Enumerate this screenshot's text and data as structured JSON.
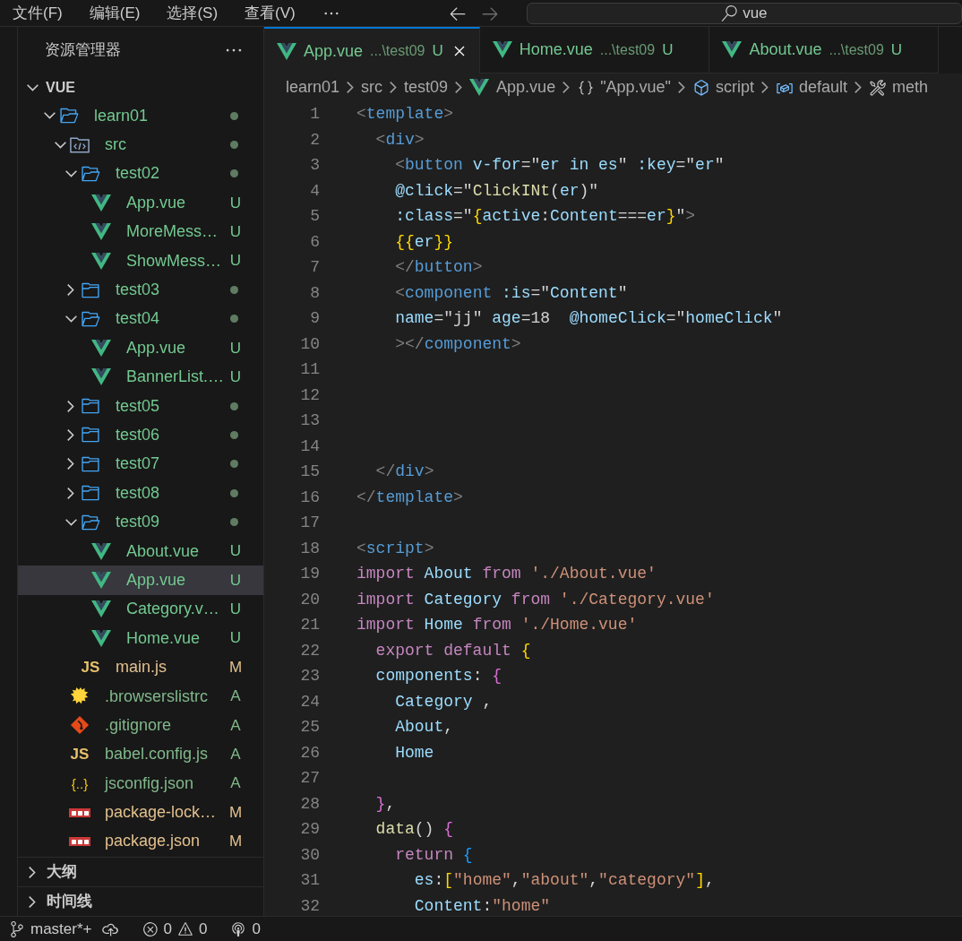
{
  "menu": [
    "文件(F)",
    "编辑(E)",
    "选择(S)",
    "查看(V)"
  ],
  "search": {
    "value": "vue"
  },
  "sidebar": {
    "title": "资源管理器",
    "section": {
      "title": "VUE",
      "expanded": true
    },
    "tree": [
      {
        "name": "learn01",
        "kind": "folder",
        "expanded": true,
        "has_changes": true,
        "children": [
          {
            "name": "src",
            "kind": "src-folder",
            "expanded": true,
            "has_changes": true,
            "children": [
              {
                "name": "test02",
                "kind": "folder",
                "expanded": true,
                "has_changes": true,
                "children": [
                  {
                    "name": "App.vue",
                    "kind": "vue",
                    "status": "U",
                    "selected": false
                  },
                  {
                    "name": "MoreMess…",
                    "kind": "vue",
                    "status": "U",
                    "selected": false
                  },
                  {
                    "name": "ShowMess…",
                    "kind": "vue",
                    "status": "U",
                    "selected": false
                  }
                ]
              },
              {
                "name": "test03",
                "kind": "folder",
                "expanded": false,
                "has_changes": true
              },
              {
                "name": "test04",
                "kind": "folder",
                "expanded": true,
                "has_changes": true,
                "children": [
                  {
                    "name": "App.vue",
                    "kind": "vue",
                    "status": "U",
                    "selected": false
                  },
                  {
                    "name": "BannerList.…",
                    "kind": "vue",
                    "status": "U",
                    "selected": false
                  }
                ]
              },
              {
                "name": "test05",
                "kind": "folder",
                "expanded": false,
                "has_changes": true
              },
              {
                "name": "test06",
                "kind": "folder",
                "expanded": false,
                "has_changes": true
              },
              {
                "name": "test07",
                "kind": "folder",
                "expanded": false,
                "has_changes": true
              },
              {
                "name": "test08",
                "kind": "folder",
                "expanded": false,
                "has_changes": true
              },
              {
                "name": "test09",
                "kind": "folder",
                "expanded": true,
                "has_changes": true,
                "children": [
                  {
                    "name": "About.vue",
                    "kind": "vue",
                    "status": "U",
                    "selected": false
                  },
                  {
                    "name": "App.vue",
                    "kind": "vue",
                    "status": "U",
                    "selected": true
                  },
                  {
                    "name": "Category.v…",
                    "kind": "vue",
                    "status": "U",
                    "selected": false
                  },
                  {
                    "name": "Home.vue",
                    "kind": "vue",
                    "status": "U",
                    "selected": false
                  }
                ]
              },
              {
                "name": "main.js",
                "kind": "js",
                "icon_text": "JS",
                "status": "M",
                "selected": false
              }
            ]
          },
          {
            "name": ".browserslistrc",
            "kind": "browserslist",
            "status": "A",
            "selected": false
          },
          {
            "name": ".gitignore",
            "kind": "git",
            "status": "A",
            "selected": false
          },
          {
            "name": "babel.config.js",
            "kind": "js",
            "icon_text": "JS",
            "status": "A",
            "selected": false
          },
          {
            "name": "jsconfig.json",
            "kind": "json",
            "icon_text": "{..}",
            "status": "A",
            "selected": false
          },
          {
            "name": "package-lock…",
            "kind": "npm",
            "status": "M",
            "selected": false
          },
          {
            "name": "package.json",
            "kind": "npm",
            "status": "M",
            "selected": false
          }
        ]
      }
    ],
    "panels": [
      {
        "title": "大纲",
        "expanded": false
      },
      {
        "title": "时间线",
        "expanded": false
      }
    ]
  },
  "tabs": [
    {
      "name": "App.vue",
      "path": "...\\test09",
      "status": "U",
      "selected": true
    },
    {
      "name": "Home.vue",
      "path": "...\\test09",
      "status": "U",
      "selected": false
    },
    {
      "name": "About.vue",
      "path": "...\\test09",
      "status": "U",
      "selected": false
    }
  ],
  "breadcrumb": [
    {
      "text": "learn01",
      "kind": "folder"
    },
    {
      "text": "src",
      "kind": "folder"
    },
    {
      "text": "test09",
      "kind": "folder"
    },
    {
      "text": "App.vue",
      "kind": "vue"
    },
    {
      "text": "\"App.vue\"",
      "kind": "braces"
    },
    {
      "text": "script",
      "kind": "method"
    },
    {
      "text": "default",
      "kind": "variable"
    },
    {
      "text": "meth",
      "kind": "tool"
    }
  ],
  "code": [
    {
      "number": "1",
      "tokens": [
        {
          "text": "<",
          "kind": "punct"
        },
        {
          "text": "template",
          "kind": "tag"
        },
        {
          "text": ">",
          "kind": "punct"
        }
      ]
    },
    {
      "number": "2",
      "tokens": [
        {
          "text": "  <",
          "kind": "punct"
        },
        {
          "text": "div",
          "kind": "tag"
        },
        {
          "text": ">",
          "kind": "punct"
        }
      ]
    },
    {
      "number": "3",
      "tokens": [
        {
          "text": "    <",
          "kind": "punct"
        },
        {
          "text": "button",
          "kind": "tag"
        },
        {
          "text": " v-for",
          "kind": "attr"
        },
        {
          "text": "=\"",
          "kind": "plain"
        },
        {
          "text": "er in es",
          "kind": "var"
        },
        {
          "text": "\" ",
          "kind": "plain"
        },
        {
          "text": ":key",
          "kind": "attr"
        },
        {
          "text": "=\"",
          "kind": "plain"
        },
        {
          "text": "er",
          "kind": "var"
        },
        {
          "text": "\"",
          "kind": "plain"
        }
      ]
    },
    {
      "number": "4",
      "tokens": [
        {
          "text": "    @click",
          "kind": "attr"
        },
        {
          "text": "=\"",
          "kind": "plain"
        },
        {
          "text": "ClickINt",
          "kind": "func"
        },
        {
          "text": "(",
          "kind": "plain"
        },
        {
          "text": "er",
          "kind": "var"
        },
        {
          "text": ")\"",
          "kind": "plain"
        }
      ]
    },
    {
      "number": "5",
      "tokens": [
        {
          "text": "    :class",
          "kind": "attr"
        },
        {
          "text": "=\"",
          "kind": "plain"
        },
        {
          "text": "{",
          "kind": "brace1"
        },
        {
          "text": "active",
          "kind": "var"
        },
        {
          "text": ":",
          "kind": "plain"
        },
        {
          "text": "Content",
          "kind": "var"
        },
        {
          "text": "===",
          "kind": "plain"
        },
        {
          "text": "er",
          "kind": "var"
        },
        {
          "text": "}",
          "kind": "brace1"
        },
        {
          "text": "\"",
          "kind": "plain"
        },
        {
          "text": ">",
          "kind": "punct"
        }
      ]
    },
    {
      "number": "6",
      "tokens": [
        {
          "text": "    {{",
          "kind": "brace1"
        },
        {
          "text": "er",
          "kind": "var"
        },
        {
          "text": "}}",
          "kind": "brace1"
        }
      ]
    },
    {
      "number": "7",
      "tokens": [
        {
          "text": "    </",
          "kind": "punct"
        },
        {
          "text": "button",
          "kind": "tag"
        },
        {
          "text": ">",
          "kind": "punct"
        }
      ]
    },
    {
      "number": "8",
      "tokens": [
        {
          "text": "    <",
          "kind": "punct"
        },
        {
          "text": "component",
          "kind": "tag"
        },
        {
          "text": " :is",
          "kind": "attr"
        },
        {
          "text": "=\"",
          "kind": "plain"
        },
        {
          "text": "Content",
          "kind": "var"
        },
        {
          "text": "\"",
          "kind": "plain"
        }
      ]
    },
    {
      "number": "9",
      "tokens": [
        {
          "text": "    name",
          "kind": "attr"
        },
        {
          "text": "=\"jj\"",
          "kind": "plain"
        },
        {
          "text": " age",
          "kind": "attr"
        },
        {
          "text": "=18  ",
          "kind": "plain"
        },
        {
          "text": "@homeClick",
          "kind": "attr"
        },
        {
          "text": "=\"",
          "kind": "plain"
        },
        {
          "text": "homeClick",
          "kind": "var"
        },
        {
          "text": "\"",
          "kind": "plain"
        }
      ]
    },
    {
      "number": "10",
      "tokens": [
        {
          "text": "    ></",
          "kind": "punct"
        },
        {
          "text": "component",
          "kind": "tag"
        },
        {
          "text": ">",
          "kind": "punct"
        }
      ]
    },
    {
      "number": "11"
    },
    {
      "number": "12"
    },
    {
      "number": "13"
    },
    {
      "number": "14"
    },
    {
      "number": "15",
      "tokens": [
        {
          "text": "  </",
          "kind": "punct"
        },
        {
          "text": "div",
          "kind": "tag"
        },
        {
          "text": ">",
          "kind": "punct"
        }
      ]
    },
    {
      "number": "16",
      "tokens": [
        {
          "text": "</",
          "kind": "punct"
        },
        {
          "text": "template",
          "kind": "tag"
        },
        {
          "text": ">",
          "kind": "punct"
        }
      ]
    },
    {
      "number": "17"
    },
    {
      "number": "18",
      "tokens": [
        {
          "text": "<",
          "kind": "punct"
        },
        {
          "text": "script",
          "kind": "tag"
        },
        {
          "text": ">",
          "kind": "punct"
        }
      ]
    },
    {
      "number": "19",
      "tokens": [
        {
          "text": "import",
          "kind": "keyword"
        },
        {
          "text": " About ",
          "kind": "var"
        },
        {
          "text": "from",
          "kind": "keyword"
        },
        {
          "text": " './About.vue'",
          "kind": "string"
        }
      ]
    },
    {
      "number": "20",
      "tokens": [
        {
          "text": "import",
          "kind": "keyword"
        },
        {
          "text": " Category ",
          "kind": "var"
        },
        {
          "text": "from",
          "kind": "keyword"
        },
        {
          "text": " './Category.vue'",
          "kind": "string"
        }
      ]
    },
    {
      "number": "21",
      "tokens": [
        {
          "text": "import",
          "kind": "keyword"
        },
        {
          "text": " Home ",
          "kind": "var"
        },
        {
          "text": "from",
          "kind": "keyword"
        },
        {
          "text": " './Home.vue'",
          "kind": "string"
        }
      ]
    },
    {
      "number": "22",
      "tokens": [
        {
          "text": "  export default ",
          "kind": "keyword"
        },
        {
          "text": "{",
          "kind": "brace1"
        }
      ]
    },
    {
      "number": "23",
      "tokens": [
        {
          "text": "  components",
          "kind": "var"
        },
        {
          "text": ": ",
          "kind": "plain"
        },
        {
          "text": "{",
          "kind": "brace2"
        }
      ]
    },
    {
      "number": "24",
      "tokens": [
        {
          "text": "    Category",
          "kind": "var"
        },
        {
          "text": " ,",
          "kind": "plain"
        }
      ]
    },
    {
      "number": "25",
      "tokens": [
        {
          "text": "    About",
          "kind": "var"
        },
        {
          "text": ",",
          "kind": "plain"
        }
      ]
    },
    {
      "number": "26",
      "tokens": [
        {
          "text": "    Home",
          "kind": "var"
        }
      ]
    },
    {
      "number": "27"
    },
    {
      "number": "28",
      "tokens": [
        {
          "text": "  }",
          "kind": "brace2"
        },
        {
          "text": ",",
          "kind": "plain"
        }
      ]
    },
    {
      "number": "29",
      "tokens": [
        {
          "text": "  data",
          "kind": "func"
        },
        {
          "text": "() ",
          "kind": "plain"
        },
        {
          "text": "{",
          "kind": "brace2"
        }
      ]
    },
    {
      "number": "30",
      "tokens": [
        {
          "text": "    return",
          "kind": "keyword"
        },
        {
          "text": " {",
          "kind": "brace3"
        }
      ]
    },
    {
      "number": "31",
      "tokens": [
        {
          "text": "      es",
          "kind": "var"
        },
        {
          "text": ":",
          "kind": "plain"
        },
        {
          "text": "[",
          "kind": "brace1"
        },
        {
          "text": "\"home\"",
          "kind": "string"
        },
        {
          "text": ",",
          "kind": "plain"
        },
        {
          "text": "\"about\"",
          "kind": "string"
        },
        {
          "text": ",",
          "kind": "plain"
        },
        {
          "text": "\"category\"",
          "kind": "string"
        },
        {
          "text": "]",
          "kind": "brace1"
        },
        {
          "text": ",",
          "kind": "plain"
        }
      ]
    },
    {
      "number": "32",
      "tokens": [
        {
          "text": "      Content",
          "kind": "var"
        },
        {
          "text": ":",
          "kind": "plain"
        },
        {
          "text": "\"home\"",
          "kind": "string"
        }
      ]
    }
  ],
  "status_bar": {
    "branch": "master*+",
    "errors": "0",
    "warnings": "0",
    "ports": "0"
  }
}
